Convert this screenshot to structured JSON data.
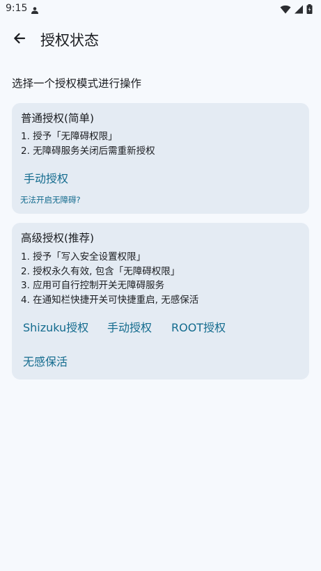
{
  "status_bar": {
    "time": "9:15",
    "icons": [
      "person-icon",
      "wifi-icon",
      "signal-icon",
      "battery-icon"
    ]
  },
  "app_bar": {
    "back_icon": "arrow-left-icon",
    "title": "授权状态"
  },
  "subtitle": "选择一个授权模式进行操作",
  "basic_card": {
    "title": "普通授权(简单)",
    "lines": [
      "1. 授予「无障碍权限」",
      "2. 无障碍服务关闭后需重新授权"
    ],
    "manual_button": "手动授权",
    "help_link": "无法开启无障碍?"
  },
  "advanced_card": {
    "title": "高级授权(推荐)",
    "lines": [
      "1. 授予「写入安全设置权限」",
      "2. 授权永久有效, 包含「无障碍权限」",
      "3. 应用可自行控制开关无障碍服务",
      "4. 在通知栏快捷开关可快捷重启, 无感保活"
    ],
    "buttons": {
      "shizuku": "Shizuku授权",
      "manual": "手动授权",
      "root": "ROOT授权",
      "keepalive": "无感保活"
    }
  },
  "colors": {
    "background": "#f6f9fd",
    "card": "#e4ebf3",
    "accent": "#136b8e",
    "text": "#1b1d21"
  }
}
